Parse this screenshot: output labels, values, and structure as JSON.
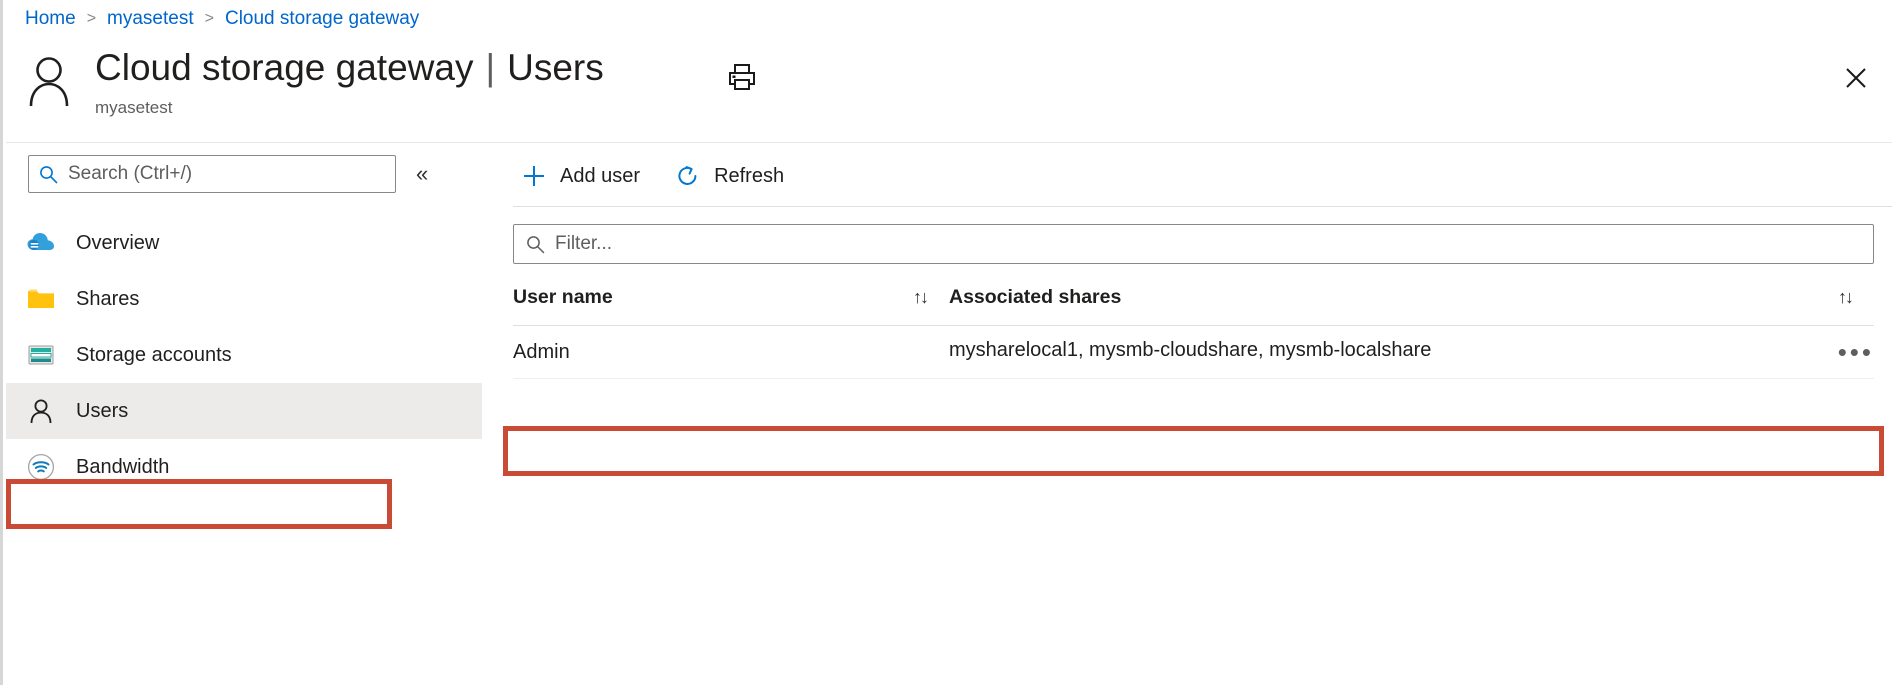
{
  "breadcrumb": {
    "items": [
      {
        "label": "Home"
      },
      {
        "label": "myasetest"
      },
      {
        "label": "Cloud storage gateway"
      }
    ],
    "separator": ">"
  },
  "header": {
    "title": "Cloud storage gateway",
    "title_separator": "|",
    "section": "Users",
    "subtitle": "myasetest",
    "print_icon": "printer-icon",
    "close_icon": "close-icon",
    "avatar_icon": "user-avatar-icon"
  },
  "sidebar": {
    "search": {
      "placeholder": "Search (Ctrl+/)",
      "value": "",
      "icon": "search-icon"
    },
    "collapse_label": "«",
    "items": [
      {
        "label": "Overview",
        "icon": "cloud-icon",
        "selected": false
      },
      {
        "label": "Shares",
        "icon": "folder-icon",
        "selected": false
      },
      {
        "label": "Storage accounts",
        "icon": "storage-account-icon",
        "selected": false
      },
      {
        "label": "Users",
        "icon": "user-icon",
        "selected": true
      },
      {
        "label": "Bandwidth",
        "icon": "bandwidth-icon",
        "selected": false
      }
    ]
  },
  "toolbar": {
    "add_user_label": "Add user",
    "add_user_icon": "plus-icon",
    "refresh_label": "Refresh",
    "refresh_icon": "refresh-icon"
  },
  "filter": {
    "placeholder": "Filter...",
    "value": "",
    "icon": "search-icon"
  },
  "table": {
    "columns": [
      {
        "label": "User name",
        "sort_icon": "sort-updown-icon"
      },
      {
        "label": "Associated shares",
        "sort_icon": "sort-updown-icon"
      }
    ],
    "sort_glyph": "↑↓",
    "rows": [
      {
        "user_name": "Admin",
        "associated_shares": "mysharelocal1, mysmb-cloudshare, mysmb-localshare",
        "menu_glyph": "•••",
        "menu_icon": "more-options-icon"
      }
    ]
  },
  "annotations": {
    "highlight_color": "#c94a35",
    "nav_highlight_target": "Users",
    "row_highlight_target": "Admin"
  },
  "colors": {
    "link": "#0066cc",
    "accent": "#0078d4",
    "text": "#201f1e",
    "muted": "#605e5c",
    "selected_bg": "#edebe9",
    "highlight": "#c94a35"
  }
}
